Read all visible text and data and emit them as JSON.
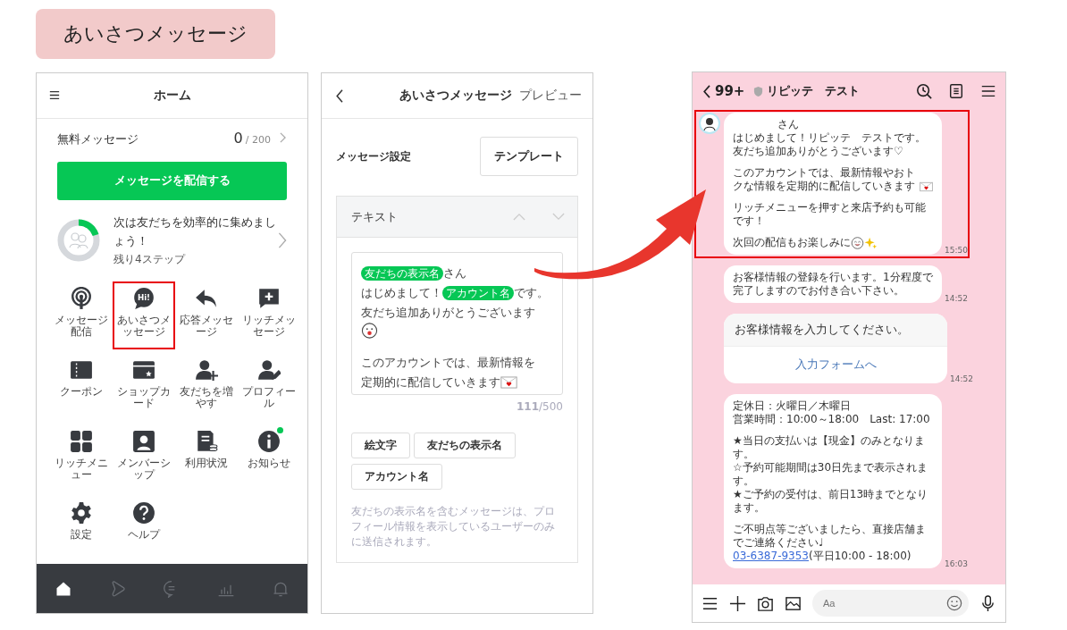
{
  "title_label": "あいさつメッセージ",
  "home": {
    "title": "ホーム",
    "free_label": "無料メッセージ",
    "free_count": "0",
    "free_total": "/ 200",
    "send_button": "メッセージを配信する",
    "progress": {
      "text": "次は友だちを効率的に集めましょう！",
      "sub": "残り4ステップ",
      "level": 0.2
    },
    "menu": [
      {
        "kind": "broadcast",
        "label": "メッセージ配信",
        "highlighted": false,
        "badge": false
      },
      {
        "kind": "greeting",
        "label": "あいさつメッセージ",
        "icon_text": "Hi!",
        "highlighted": true,
        "badge": false
      },
      {
        "kind": "reply",
        "label": "応答メッセージ",
        "highlighted": false,
        "badge": false
      },
      {
        "kind": "rich-message",
        "label": "リッチメッセージ",
        "highlighted": false,
        "badge": false
      },
      {
        "kind": "coupon",
        "label": "クーポン",
        "highlighted": false,
        "badge": false
      },
      {
        "kind": "shop-card",
        "label": "ショップカード",
        "highlighted": false,
        "badge": false
      },
      {
        "kind": "add-friend",
        "label": "友だちを増やす",
        "highlighted": false,
        "badge": false
      },
      {
        "kind": "profile",
        "label": "プロフィール",
        "highlighted": false,
        "badge": false
      },
      {
        "kind": "rich-menu",
        "label": "リッチメニュー",
        "highlighted": false,
        "badge": false
      },
      {
        "kind": "membership",
        "label": "メンバーシップ",
        "highlighted": false,
        "badge": false
      },
      {
        "kind": "usage",
        "label": "利用状況",
        "highlighted": false,
        "badge": false
      },
      {
        "kind": "notice",
        "label": "お知らせ",
        "highlighted": false,
        "badge": true
      },
      {
        "kind": "settings",
        "label": "設定",
        "highlighted": false,
        "badge": false
      },
      {
        "kind": "help",
        "label": "ヘルプ",
        "highlighted": false,
        "badge": false
      }
    ],
    "nav": [
      {
        "kind": "home",
        "selected": true
      },
      {
        "kind": "play",
        "selected": false
      },
      {
        "kind": "chat",
        "selected": false
      },
      {
        "kind": "chart",
        "selected": false
      },
      {
        "kind": "bell",
        "selected": false
      }
    ]
  },
  "editor": {
    "title": "あいさつメッセージ",
    "preview": "プレビュー",
    "setting_label": "メッセージ設定",
    "template_button": "テンプレート",
    "section": "テキスト",
    "paragraphs": [
      [
        [
          {
            "kind": "tag",
            "text": "友だちの表示名"
          },
          {
            "kind": "text",
            "text": "さん"
          }
        ],
        [
          {
            "kind": "text",
            "text": "はじめまして！"
          },
          {
            "kind": "tag",
            "text": "アカウント名"
          },
          {
            "kind": "text",
            "text": "です。"
          }
        ],
        [
          {
            "kind": "text",
            "text": "友だち追加ありがとうございます"
          }
        ],
        [
          {
            "kind": "face"
          }
        ]
      ],
      [
        [
          {
            "kind": "text",
            "text": "このアカウントでは、最新情報を"
          }
        ],
        [
          {
            "kind": "text",
            "text": "定期的に配信していきます"
          },
          {
            "kind": "envelope"
          }
        ]
      ]
    ],
    "count": "111",
    "max": "/500",
    "insert_buttons": [
      "絵文字",
      "友だちの表示名",
      "アカウント名"
    ],
    "note": "友だちの表示名を含むメッセージは、プロフィール情報を表示しているユーザーのみに送信されます。"
  },
  "chat": {
    "back": "99+",
    "name": "リピッテ　テスト",
    "messages": [
      {
        "kind": "bubble",
        "avatar": true,
        "highlighted": true,
        "time": "15:50",
        "paragraphs": [
          [
            [
              {
                "kind": "blank"
              },
              {
                "kind": "text",
                "text": "さん"
              }
            ],
            [
              {
                "kind": "text",
                "text": "はじめまして！リピッテ　テストです。"
              }
            ],
            [
              {
                "kind": "text",
                "text": "友だち追加ありがとうございます♡"
              }
            ]
          ],
          [
            [
              {
                "kind": "text",
                "text": "このアカウントでは、最新情報やおトクな情報を定期的に配信していきます"
              },
              {
                "kind": "envelope"
              }
            ]
          ],
          [
            [
              {
                "kind": "text",
                "text": "リッチメニューを押すと来店予約も可能です！"
              }
            ]
          ],
          [
            [
              {
                "kind": "text",
                "text": "次回の配信もお楽しみに"
              },
              {
                "kind": "face"
              },
              {
                "kind": "sparkle"
              }
            ]
          ]
        ]
      },
      {
        "kind": "bubble",
        "avatar": false,
        "highlighted": false,
        "time": "14:52",
        "paragraphs": [
          [
            [
              {
                "kind": "text",
                "text": "お客様情報の登録を行います。1分程度で完了しますのでお付き合い下さい。"
              }
            ]
          ]
        ]
      },
      {
        "kind": "card",
        "title": "お客様情報を入力してください。",
        "action": "入力フォームへ",
        "time": "14:52"
      },
      {
        "kind": "bubble",
        "avatar": false,
        "highlighted": false,
        "time": "16:03",
        "paragraphs": [
          [
            [
              {
                "kind": "text",
                "text": "定休日：火曜日／木曜日"
              }
            ],
            [
              {
                "kind": "text",
                "text": "営業時間：10:00～18:00　Last: 17:00"
              }
            ]
          ],
          [
            [
              {
                "kind": "text",
                "text": "★当日の支払いは【現金】のみとなります。"
              }
            ],
            [
              {
                "kind": "text",
                "text": "☆予約可能期間は30日先まで表示されます。"
              }
            ],
            [
              {
                "kind": "text",
                "text": "★ご予約の受付は、前日13時までとなります。"
              }
            ]
          ],
          [
            [
              {
                "kind": "text",
                "text": "ご不明点等ございましたら、直接店舗までご連絡ください♩"
              }
            ],
            [
              {
                "kind": "link",
                "text": "03-6387-9353"
              },
              {
                "kind": "text",
                "text": " (平日10:00 - 18:00)"
              }
            ]
          ]
        ]
      }
    ],
    "input_placeholder": "Aa"
  }
}
